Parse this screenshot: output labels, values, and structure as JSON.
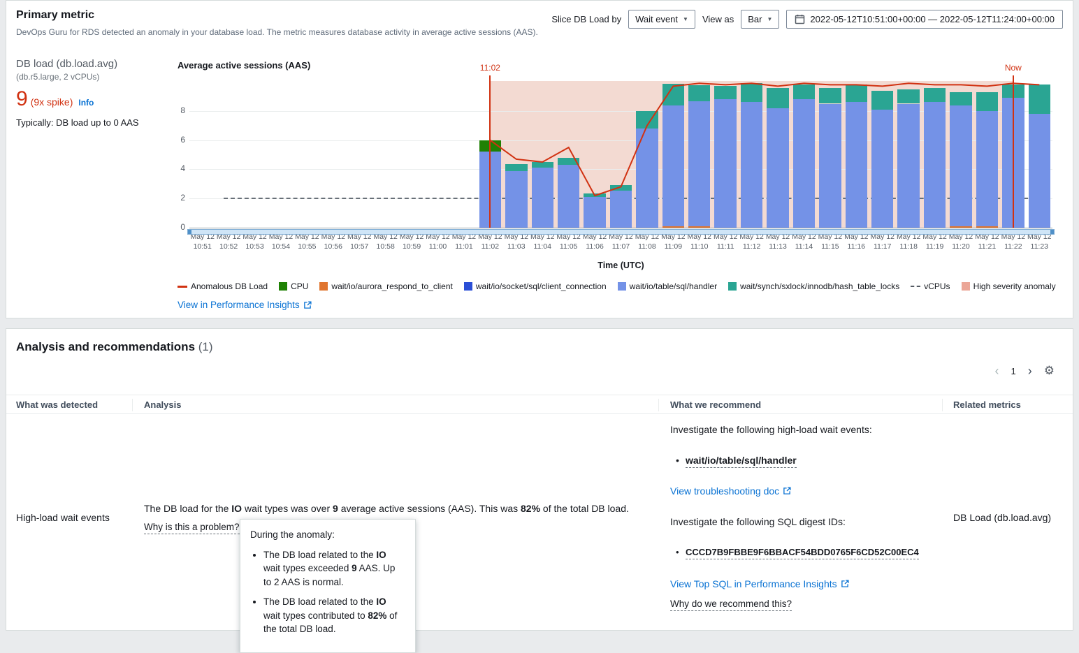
{
  "icons": {
    "caret_down": "▼",
    "gear": "⚙",
    "chevron_left": "‹",
    "chevron_right": "›",
    "bullet": "•"
  },
  "primary_metric": {
    "title": "Primary metric",
    "subtitle": "DevOps Guru for RDS detected an anomaly in your database load. The metric measures database activity in average active sessions (AAS).",
    "controls": {
      "slice_label": "Slice DB Load by",
      "slice_value": "Wait event",
      "view_as_label": "View as",
      "view_as_value": "Bar",
      "date_range": "2022-05-12T10:51:00+00:00 — 2022-05-12T11:24:00+00:00"
    },
    "metric": {
      "name": "DB load (db.load.avg)",
      "instance": "(db.r5.large, 2 vCPUs)",
      "value": "9",
      "spike": "(9x spike)",
      "info": "Info",
      "typical": "Typically: DB load up to 0 AAS"
    },
    "chart_title": "Average active sessions (AAS)",
    "performance_insights_link": "View in Performance Insights"
  },
  "chart_data": {
    "type": "bar",
    "title": "Average active sessions (AAS)",
    "xlabel": "Time (UTC)",
    "ylabel": "",
    "ylim": [
      0,
      10.2
    ],
    "yticks": [
      0,
      2,
      4,
      6,
      8
    ],
    "x_date": "May 12",
    "x": [
      "10:51",
      "10:52",
      "10:53",
      "10:54",
      "10:55",
      "10:56",
      "10:57",
      "10:58",
      "10:59",
      "11:00",
      "11:01",
      "11:02",
      "11:03",
      "11:04",
      "11:05",
      "11:06",
      "11:07",
      "11:08",
      "11:09",
      "11:10",
      "11:11",
      "11:12",
      "11:13",
      "11:14",
      "11:15",
      "11:16",
      "11:17",
      "11:18",
      "11:19",
      "11:20",
      "11:21",
      "11:22",
      "11:23"
    ],
    "bar_start_index": 11,
    "anomaly_start_index": 11,
    "anomaly_start_label": "11:02",
    "now_index": 31.5,
    "now_label": "Now",
    "vcpus": 2,
    "anomaly_region_color": "#f3dad2",
    "series": [
      {
        "name": "wait/io/aurora_respond_to_client",
        "color": "#e0752f",
        "values": [
          0,
          0,
          0,
          0,
          0,
          0,
          0,
          0.08,
          0.08,
          0,
          0,
          0,
          0,
          0,
          0,
          0,
          0,
          0,
          0.1,
          0.1,
          0,
          0
        ]
      },
      {
        "name": "wait/io/table/sql/handler",
        "color": "#7492e7",
        "values": [
          5.2,
          3.9,
          4.1,
          4.3,
          2.1,
          2.55,
          6.8,
          8.3,
          8.6,
          8.8,
          8.6,
          8.2,
          8.8,
          8.5,
          8.6,
          8.1,
          8.5,
          8.6,
          8.3,
          7.9,
          8.9,
          7.8
        ]
      },
      {
        "name": "wait/synch/sxlock/innodb/hash_table_locks",
        "color": "#2aa593",
        "values": [
          0,
          0.45,
          0.4,
          0.5,
          0.25,
          0.35,
          1.2,
          1.5,
          1.1,
          0.9,
          1.3,
          1.4,
          1.0,
          1.1,
          1.2,
          1.3,
          1.0,
          1.0,
          0.9,
          1.3,
          0.9,
          2.0
        ]
      },
      {
        "name": "CPU",
        "color": "#1f8104",
        "values": [
          0.8,
          0,
          0,
          0,
          0,
          0,
          0,
          0,
          0,
          0,
          0,
          0,
          0,
          0,
          0,
          0,
          0,
          0,
          0,
          0,
          0,
          0
        ]
      }
    ],
    "line": {
      "name": "Anomalous DB Load",
      "color": "#d13212",
      "values": [
        6.0,
        4.7,
        4.5,
        5.5,
        2.2,
        2.8,
        7.0,
        9.7,
        9.9,
        9.8,
        9.9,
        9.7,
        9.9,
        9.8,
        9.8,
        9.7,
        9.9,
        9.8,
        9.8,
        9.7,
        9.9,
        9.8
      ]
    }
  },
  "legend": {
    "items": [
      {
        "label": "Anomalous DB Load",
        "type": "line",
        "color": "#d13212"
      },
      {
        "label": "CPU",
        "type": "box",
        "color": "#1f8104"
      },
      {
        "label": "wait/io/aurora_respond_to_client",
        "type": "box",
        "color": "#e0752f"
      },
      {
        "label": "wait/io/socket/sql/client_connection",
        "type": "box",
        "color": "#2b4fd6"
      },
      {
        "label": "wait/io/table/sql/handler",
        "type": "box",
        "color": "#7492e7"
      },
      {
        "label": "wait/synch/sxlock/innodb/hash_table_locks",
        "type": "box",
        "color": "#2aa593"
      },
      {
        "label": "vCPUs",
        "type": "dash",
        "color": "#545b64"
      },
      {
        "label": "High severity anomaly",
        "type": "box",
        "color": "#eba697"
      }
    ]
  },
  "analysis_panel": {
    "title": "Analysis and recommendations",
    "count": "(1)",
    "page": "1",
    "columns": [
      "What was detected",
      "Analysis",
      "What we recommend",
      "Related metrics"
    ],
    "row": {
      "detected": "High-load wait events",
      "analysis": {
        "s0": "The DB load for the ",
        "s1": "IO",
        "s2": " wait types was over ",
        "s3": "9",
        "s4": " average active sessions (AAS). This was ",
        "s5": "82%",
        "s6": " of the total DB load."
      },
      "why_problem": "Why is this a problem?",
      "tooltip": {
        "title": "During the anomaly:",
        "b1": {
          "s0": "The DB load related to the ",
          "s1": "IO",
          "s2": " wait types exceeded ",
          "s3": "9",
          "s4": " AAS. Up to 2 AAS is normal."
        },
        "b2": {
          "s0": "The DB load related to the ",
          "s1": "IO",
          "s2": " wait types contributed to ",
          "s3": "82%",
          "s4": " of the total DB load."
        }
      },
      "recommend": {
        "investigate_waits": "Investigate the following high-load wait events:",
        "wait_event": "wait/io/table/sql/handler",
        "troubleshooting_link": "View troubleshooting doc",
        "investigate_sql": "Investigate the following SQL digest IDs:",
        "sql_digest": "CCCD7B9FBBE9F6BBACF54BDD0765F6CD52C00EC4",
        "top_sql_link": "View Top SQL in Performance Insights",
        "why_recommend": "Why do we recommend this?"
      },
      "related_metric": "DB Load (db.load.avg)"
    }
  }
}
